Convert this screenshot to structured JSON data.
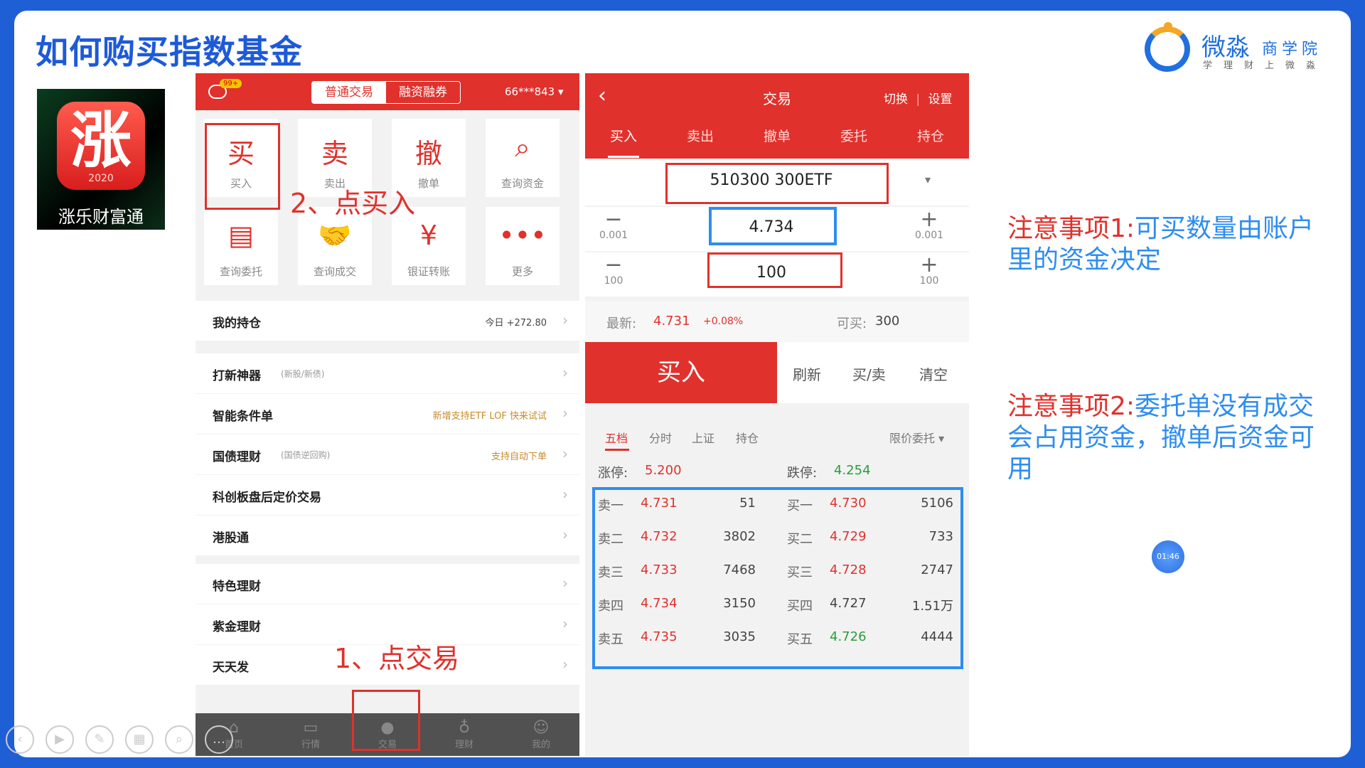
{
  "slide": {
    "title": "如何购买指数基金",
    "brand_name": "微淼",
    "brand_sub": "商学院",
    "brand_tag": "学理财上微淼",
    "timer": "01:46"
  },
  "app_icon": {
    "glyph": "涨",
    "year": "2020",
    "name": "涨乐财富通"
  },
  "phone1": {
    "badge": "99+",
    "seg_tabs": [
      "普通交易",
      "融资融券"
    ],
    "account": "66***843",
    "grid": [
      {
        "icon": "买",
        "label": "买入"
      },
      {
        "icon": "卖",
        "label": "卖出"
      },
      {
        "icon": "撤",
        "label": "撤单"
      },
      {
        "icon": "search-icon",
        "label": "查询资金"
      },
      {
        "icon": "document-icon",
        "label": "查询委托"
      },
      {
        "icon": "handshake-icon",
        "label": "查询成交"
      },
      {
        "icon": "yen-transfer-icon",
        "label": "银证转账"
      },
      {
        "icon": "more-icon",
        "label": "更多"
      }
    ],
    "holdings": {
      "label": "我的持仓",
      "today": "今日 +272.80"
    },
    "rows": [
      {
        "title": "打新神器",
        "sub": "(新股/新债)",
        "right": ""
      },
      {
        "title": "智能条件单",
        "sub": "",
        "right": "新增支持ETF LOF 快来试试"
      },
      {
        "title": "国债理财",
        "sub": "(国债逆回购)",
        "right": "支持自动下单"
      },
      {
        "title": "科创板盘后定价交易",
        "sub": "",
        "right": ""
      },
      {
        "title": "港股通",
        "sub": "",
        "right": ""
      },
      {
        "title": "特色理财",
        "sub": "",
        "right": ""
      },
      {
        "title": "紫金理财",
        "sub": "",
        "right": ""
      },
      {
        "title": "天天发",
        "sub": "",
        "right": ""
      }
    ],
    "tabbar": [
      "首页",
      "行情",
      "交易",
      "理财",
      "我的"
    ],
    "annotation_buy": "2、点买入",
    "annotation_trade": "1、点交易"
  },
  "phone2": {
    "title": "交易",
    "switch": "切换",
    "settings": "设置",
    "tabs": [
      "买入",
      "卖出",
      "撤单",
      "委托",
      "持仓"
    ],
    "code": "510300 300ETF",
    "price": "4.734",
    "price_step": "0.001",
    "qty": "100",
    "qty_step": "100",
    "latest_label": "最新:",
    "latest": "4.731",
    "change": "+0.08%",
    "can_buy_label": "可买:",
    "can_buy": "300",
    "buy": "买入",
    "refresh": "刷新",
    "buy_sell": "买/卖",
    "clear": "清空",
    "subtabs": [
      "五档",
      "分时",
      "上证",
      "持仓"
    ],
    "order_type": "限价委托",
    "limit_up_label": "涨停:",
    "limit_up": "5.200",
    "limit_down_label": "跌停:",
    "limit_down": "4.254",
    "book": [
      {
        "sl": "卖一",
        "sp": "4.731",
        "sv": "51",
        "bl": "买一",
        "bp": "4.730",
        "bv": "5106"
      },
      {
        "sl": "卖二",
        "sp": "4.732",
        "sv": "3802",
        "bl": "买二",
        "bp": "4.729",
        "bv": "733"
      },
      {
        "sl": "卖三",
        "sp": "4.733",
        "sv": "7468",
        "bl": "买三",
        "bp": "4.728",
        "bv": "2747"
      },
      {
        "sl": "卖四",
        "sp": "4.734",
        "sv": "3150",
        "bl": "买四",
        "bp": "4.727",
        "bv": "1.51万"
      },
      {
        "sl": "卖五",
        "sp": "4.735",
        "sv": "3035",
        "bl": "买五",
        "bp": "4.726",
        "bv": "4444"
      }
    ]
  },
  "notes": [
    {
      "label": "注意事项1:",
      "text": "可买数量由账户里的资金决定"
    },
    {
      "label": "注意事项2:",
      "text": "委托单没有成交会占用资金，撤单后资金可用"
    }
  ],
  "colors": {
    "brand_blue": "#1d5ad8",
    "trade_red": "#e0312c",
    "note_blue": "#2e8df0",
    "down_green": "#2a9d3a"
  }
}
